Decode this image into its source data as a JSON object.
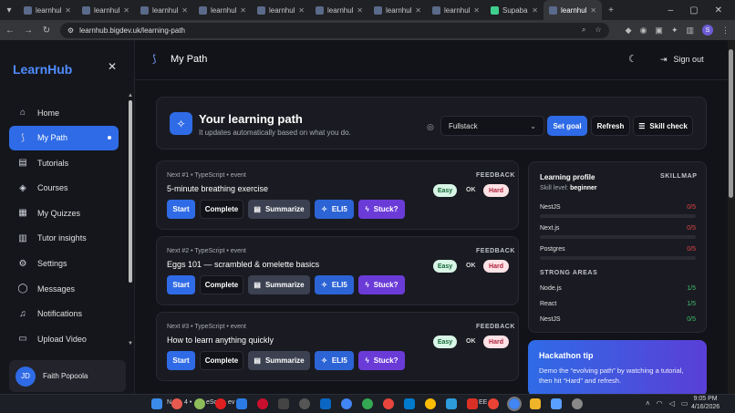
{
  "browser": {
    "tabs": [
      {
        "label": "learnhub.b",
        "active": false
      },
      {
        "label": "learnhub.b",
        "active": false
      },
      {
        "label": "learnhub.b",
        "active": false
      },
      {
        "label": "learnhub.b",
        "active": false
      },
      {
        "label": "learnhub.b",
        "active": false
      },
      {
        "label": "learnhub.b",
        "active": false
      },
      {
        "label": "learnhub.b",
        "active": false
      },
      {
        "label": "learnhub.b",
        "active": false
      },
      {
        "label": "Supabase",
        "active": false
      },
      {
        "label": "learnhub.b",
        "active": true
      }
    ],
    "url": "learnhub.bigdev.uk/learning-path",
    "profile_initial": "S"
  },
  "sidebar": {
    "brand": "LearnHub",
    "items": [
      {
        "label": "Home",
        "icon": "home-icon"
      },
      {
        "label": "My Path",
        "icon": "path-icon",
        "active": true
      },
      {
        "label": "Tutorials",
        "icon": "book-icon"
      },
      {
        "label": "Courses",
        "icon": "layers-icon"
      },
      {
        "label": "My Quizzes",
        "icon": "clipboard-icon"
      },
      {
        "label": "Tutor insights",
        "icon": "chart-icon"
      },
      {
        "label": "Settings",
        "icon": "gear-icon"
      },
      {
        "label": "Messages",
        "icon": "message-icon"
      },
      {
        "label": "Notifications",
        "icon": "bell-icon"
      },
      {
        "label": "Upload Video",
        "icon": "video-icon"
      }
    ],
    "user": {
      "initials": "JD",
      "name": "Faith Popoola"
    }
  },
  "header": {
    "title": "My Path",
    "signout": "Sign out"
  },
  "learning_path": {
    "title": "Your learning path",
    "subtitle": "It updates automatically based on what you do.",
    "goal_value": "Fullstack",
    "set_goal": "Set goal",
    "refresh": "Refresh",
    "skill_check": "Skill check"
  },
  "steps": [
    {
      "meta": "Next #1 • TypeScript • event",
      "title": "5-minute breathing exercise"
    },
    {
      "meta": "Next #2 • TypeScript • event",
      "title": "Eggs 101 — scrambled & omelette basics"
    },
    {
      "meta": "Next #3 • TypeScript • event",
      "title": "How to learn anything quickly"
    }
  ],
  "step_labels": {
    "feedback": "FEEDBACK",
    "start": "Start",
    "complete": "Complete",
    "summarize": "Summarize",
    "eli5": "ELI5",
    "stuck": "Stuck?",
    "easy": "Easy",
    "ok": "OK",
    "hard": "Hard"
  },
  "profile": {
    "title": "Learning profile",
    "skillmap": "SKILLMAP",
    "skill_level_label": "Skill level:",
    "skill_level": "beginner",
    "skills": [
      {
        "name": "NestJS",
        "score": "0/5"
      },
      {
        "name": "Next.js",
        "score": "0/5"
      },
      {
        "name": "Postgres",
        "score": "0/5"
      }
    ],
    "strong_title": "STRONG AREAS",
    "strong": [
      {
        "name": "Node.js",
        "score": "1/5"
      },
      {
        "name": "React",
        "score": "1/5"
      },
      {
        "name": "NestJS",
        "score": "0/5"
      }
    ]
  },
  "tip": {
    "title": "Hackathon tip",
    "text": "Demo the “evolving path” by watching a tutorial, then hit “Hard” and refresh."
  },
  "taskbar": {
    "time": "9:05 PM",
    "date": "4/16/2026",
    "label_a": "N",
    "label_b": "4 •",
    "label_c": "eSc",
    "label_d": "ev",
    "label_e": "EE"
  },
  "colors": {
    "accent": "#2f6be6",
    "stuck": "#6b3bd8",
    "danger": "#e04545",
    "success": "#3fbf6a"
  }
}
